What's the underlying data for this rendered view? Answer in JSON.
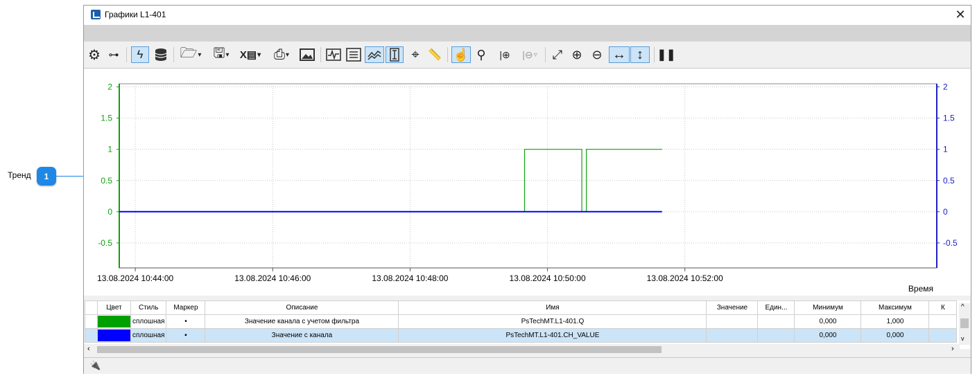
{
  "callout": {
    "label": "Тренд",
    "number": "1"
  },
  "window": {
    "title": "Графики L1-401",
    "close_glyph": "✕"
  },
  "toolbar": {
    "icons": [
      "gear-icon",
      "tree-icon",
      "lightning-icon",
      "database-icon",
      "open-folder-icon",
      "save-icon",
      "excel-icon",
      "print-icon",
      "image-icon",
      "pulse-icon",
      "list-icon",
      "trend-lines-icon",
      "cursor-bracket-icon",
      "target-icon",
      "ruler-icon",
      "hand-pointer-icon",
      "zoom-icon",
      "add-marker-icon",
      "remove-marker-icon",
      "fit-all-icon",
      "zoom-in-icon",
      "zoom-out-icon",
      "horizontal-scale-icon",
      "vertical-scale-icon",
      "pause-icon"
    ]
  },
  "chart_data": {
    "type": "line",
    "x_unit": "time",
    "xlabel": "Время",
    "x_ticks": [
      "13.08.2024 10:44:00",
      "13.08.2024 10:46:00",
      "13.08.2024 10:48:00",
      "13.08.2024 10:50:00",
      "13.08.2024 10:52:00"
    ],
    "left_axis": {
      "ylim": [
        -0.9,
        2.05
      ],
      "ticks": [
        "2",
        "1.5",
        "1",
        "0.5",
        "0",
        "-0.5"
      ],
      "color": "#10a010"
    },
    "right_axis": {
      "ylim": [
        -0.9,
        2.05
      ],
      "ticks": [
        "2",
        "1.5",
        "1",
        "0.5",
        "0",
        "-0.5"
      ],
      "color": "#2020c0"
    },
    "grid": true,
    "xlim": [
      "10:43:46",
      "10:55:40"
    ],
    "series": [
      {
        "color": "#10a010",
        "x": [
          "10:43:46",
          "10:49:40",
          "10:49:40",
          "10:50:30",
          "10:50:30",
          "10:50:34",
          "10:50:34",
          "10:51:40"
        ],
        "values": [
          0,
          0,
          1,
          1,
          0,
          0,
          1,
          1
        ]
      },
      {
        "color": "#0000ff",
        "x": [
          "10:43:46",
          "10:51:40"
        ],
        "values": [
          0,
          0
        ]
      }
    ]
  },
  "table": {
    "columns": [
      "Цвет",
      "Стиль",
      "Маркер",
      "Описание",
      "Имя",
      "Значение",
      "Един...",
      "Минимум",
      "Максимум",
      "К"
    ],
    "rows": [
      {
        "color": "#00a000",
        "style": "сплошная",
        "marker": "•",
        "description": "Значение канала с учетом фильтра",
        "name": "PsTechMT.L1-401.Q",
        "value": "",
        "unit": "",
        "min": "0,000",
        "max": "1,000",
        "k": ""
      },
      {
        "color": "#0000ff",
        "style": "сплошная",
        "marker": "▪",
        "description": "Значение с канала",
        "name": "PsTechMT.L1-401.CH_VALUE",
        "value": "",
        "unit": "",
        "min": "0,000",
        "max": "0,000",
        "k": ""
      }
    ]
  },
  "statusbar": {
    "icon": "plug-icon"
  }
}
